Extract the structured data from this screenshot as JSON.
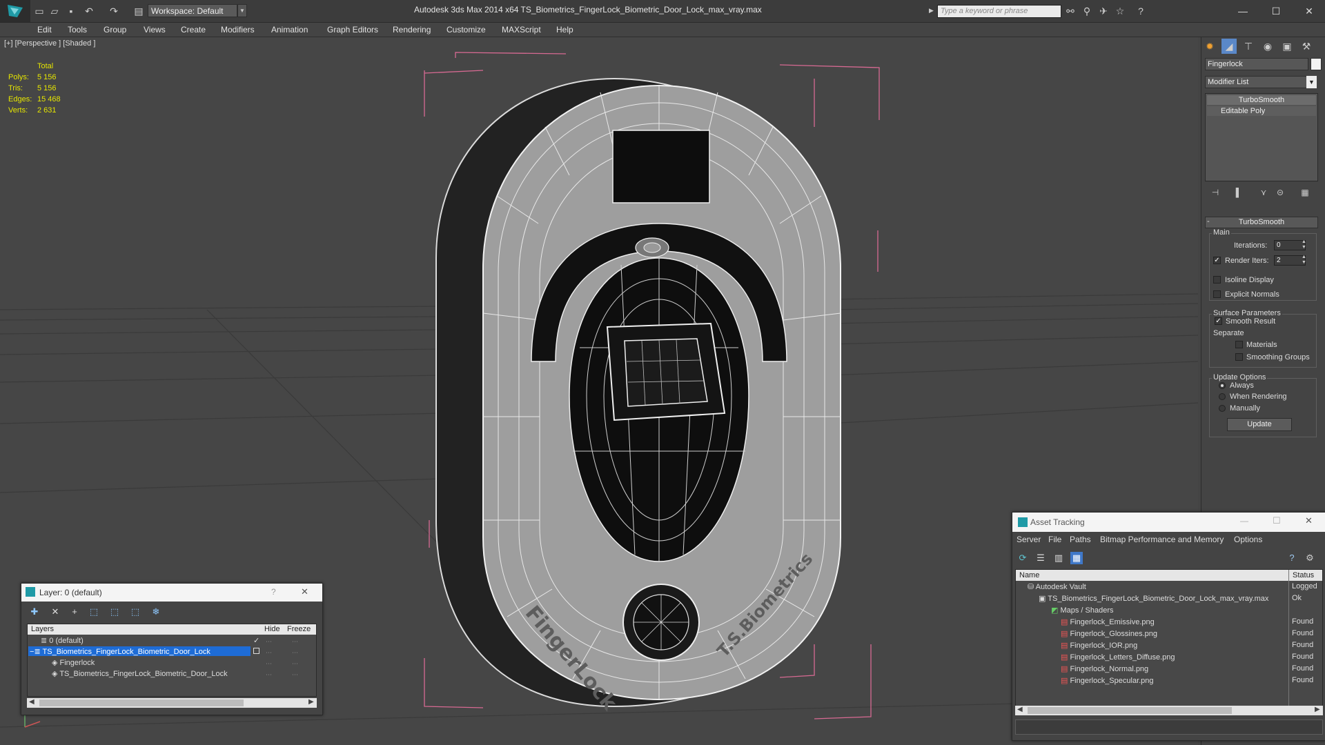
{
  "window": {
    "title": "Autodesk 3ds Max 2014 x64      TS_Biometrics_FingerLock_Biometric_Door_Lock_max_vray.max",
    "workspace": "Workspace: Default",
    "search_placeholder": "Type a keyword or phrase"
  },
  "menu": [
    "Edit",
    "Tools",
    "Group",
    "Views",
    "Create",
    "Modifiers",
    "Animation",
    "Graph Editors",
    "Rendering",
    "Customize",
    "MAXScript",
    "Help"
  ],
  "viewport": {
    "label": "[+] [Perspective ] [Shaded ]",
    "stats": {
      "header": "Total",
      "rows": [
        {
          "label": "Polys:",
          "value": "5 156"
        },
        {
          "label": "Tris:",
          "value": "5 156"
        },
        {
          "label": "Edges:",
          "value": "15 468"
        },
        {
          "label": "Verts:",
          "value": "2 631"
        }
      ]
    },
    "text_left": "FingerLock",
    "text_right": "T.S.Biometrics"
  },
  "command_panel": {
    "object_name": "Fingerlock",
    "modifier_list": "Modifier List",
    "stack": [
      "TurboSmooth",
      "Editable Poly"
    ],
    "rollout": "TurboSmooth",
    "main_group": "Main",
    "iterations_label": "Iterations:",
    "iterations_value": "0",
    "render_iters_label": "Render Iters:",
    "render_iters_value": "2",
    "isoline": "Isoline Display",
    "explicit_normals": "Explicit Normals",
    "surface_group": "Surface Parameters",
    "smooth_result": "Smooth Result",
    "separate": "Separate",
    "materials": "Materials",
    "smoothing_groups": "Smoothing Groups",
    "update_group": "Update Options",
    "always": "Always",
    "when_rendering": "When Rendering",
    "manually": "Manually",
    "update_button": "Update"
  },
  "layer_window": {
    "title": "Layer: 0 (default)",
    "help": "?",
    "col_layers": "Layers",
    "col_hide": "Hide",
    "col_freeze": "Freeze",
    "rows": [
      "0 (default)",
      "TS_Biometrics_FingerLock_Biometric_Door_Lock",
      "Fingerlock",
      "TS_Biometrics_FingerLock_Biometric_Door_Lock"
    ]
  },
  "asset_window": {
    "title": "Asset Tracking",
    "menu": [
      "Server",
      "File",
      "Paths",
      "Bitmap Performance and Memory",
      "Options"
    ],
    "col_name": "Name",
    "col_status": "Status",
    "rows": [
      {
        "name": "Autodesk Vault",
        "status": "Logged"
      },
      {
        "name": "TS_Biometrics_FingerLock_Biometric_Door_Lock_max_vray.max",
        "status": "Ok"
      },
      {
        "name": "Maps / Shaders",
        "status": ""
      },
      {
        "name": "Fingerlock_Emissive.png",
        "status": "Found"
      },
      {
        "name": "Fingerlock_Glossines.png",
        "status": "Found"
      },
      {
        "name": "Fingerlock_IOR.png",
        "status": "Found"
      },
      {
        "name": "Fingerlock_Letters_Diffuse.png",
        "status": "Found"
      },
      {
        "name": "Fingerlock_Normal.png",
        "status": "Found"
      },
      {
        "name": "Fingerlock_Specular.png",
        "status": "Found"
      }
    ]
  },
  "colors": {
    "accent": "#3399ff",
    "stats_yellow": "#e6e600",
    "selection_blue": "#1e6cd6"
  }
}
